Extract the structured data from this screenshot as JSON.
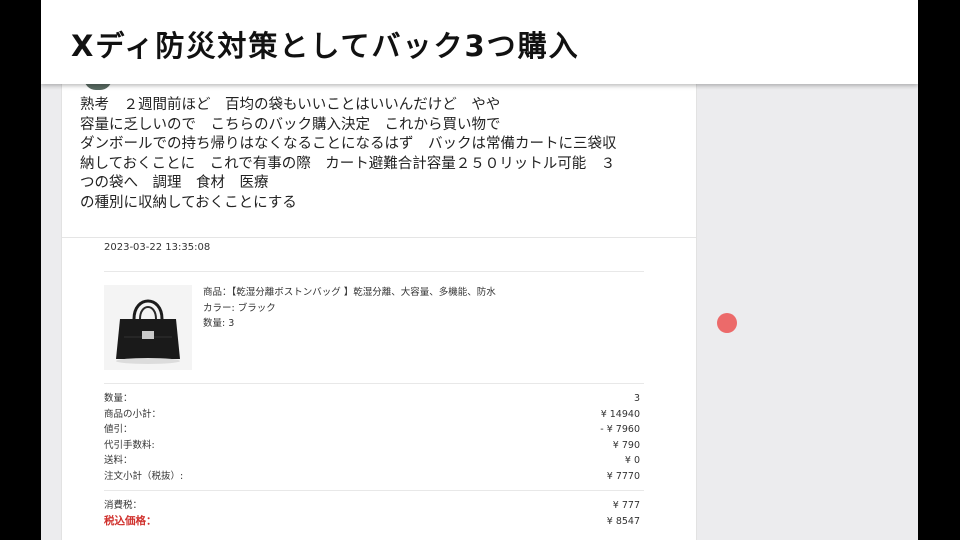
{
  "title": "Xディ防災対策としてバック3つ購入",
  "post": {
    "text": "熟考　２週間前ほど　百均の袋もいいことはいいんだけど　やや\n容量に乏しいので　こちらのバック購入決定　これから買い物で\nダンボールでの持ち帰りはなくなることになるはず　バックは常備カートに三袋収\n納しておくことに　これで有事の際　カート避難合計容量２５０リットル可能　３\nつの袋へ　調理　食材　医療\nの種別に収納しておくことにする"
  },
  "order": {
    "timestamp": "2023-03-22 13:35:08",
    "product": {
      "name": "商品：【乾湿分離ボストンバッグ 】乾湿分離、大容量、多機能、防水",
      "color": "カラー: ブラック",
      "qty": "数量: 3",
      "image": "black-boston-bag"
    },
    "summary": [
      {
        "label": "数量：",
        "value": "3"
      },
      {
        "label": "商品の小計：",
        "value": "¥ 14940"
      },
      {
        "label": "値引：",
        "value": "- ¥ 7960"
      },
      {
        "label": "代引手数料:",
        "value": "¥ 790"
      },
      {
        "label": "送料：",
        "value": "¥ 0"
      },
      {
        "label": "注文小計（税抜）:",
        "value": "¥ 7770"
      }
    ],
    "tax": {
      "label": "消費税：",
      "value": "¥ 777"
    },
    "total": {
      "label": "税込価格：",
      "value": "¥ 8547",
      "label_color": "#d0312d"
    }
  },
  "colors": {
    "record_dot": "#ec6a6a"
  }
}
